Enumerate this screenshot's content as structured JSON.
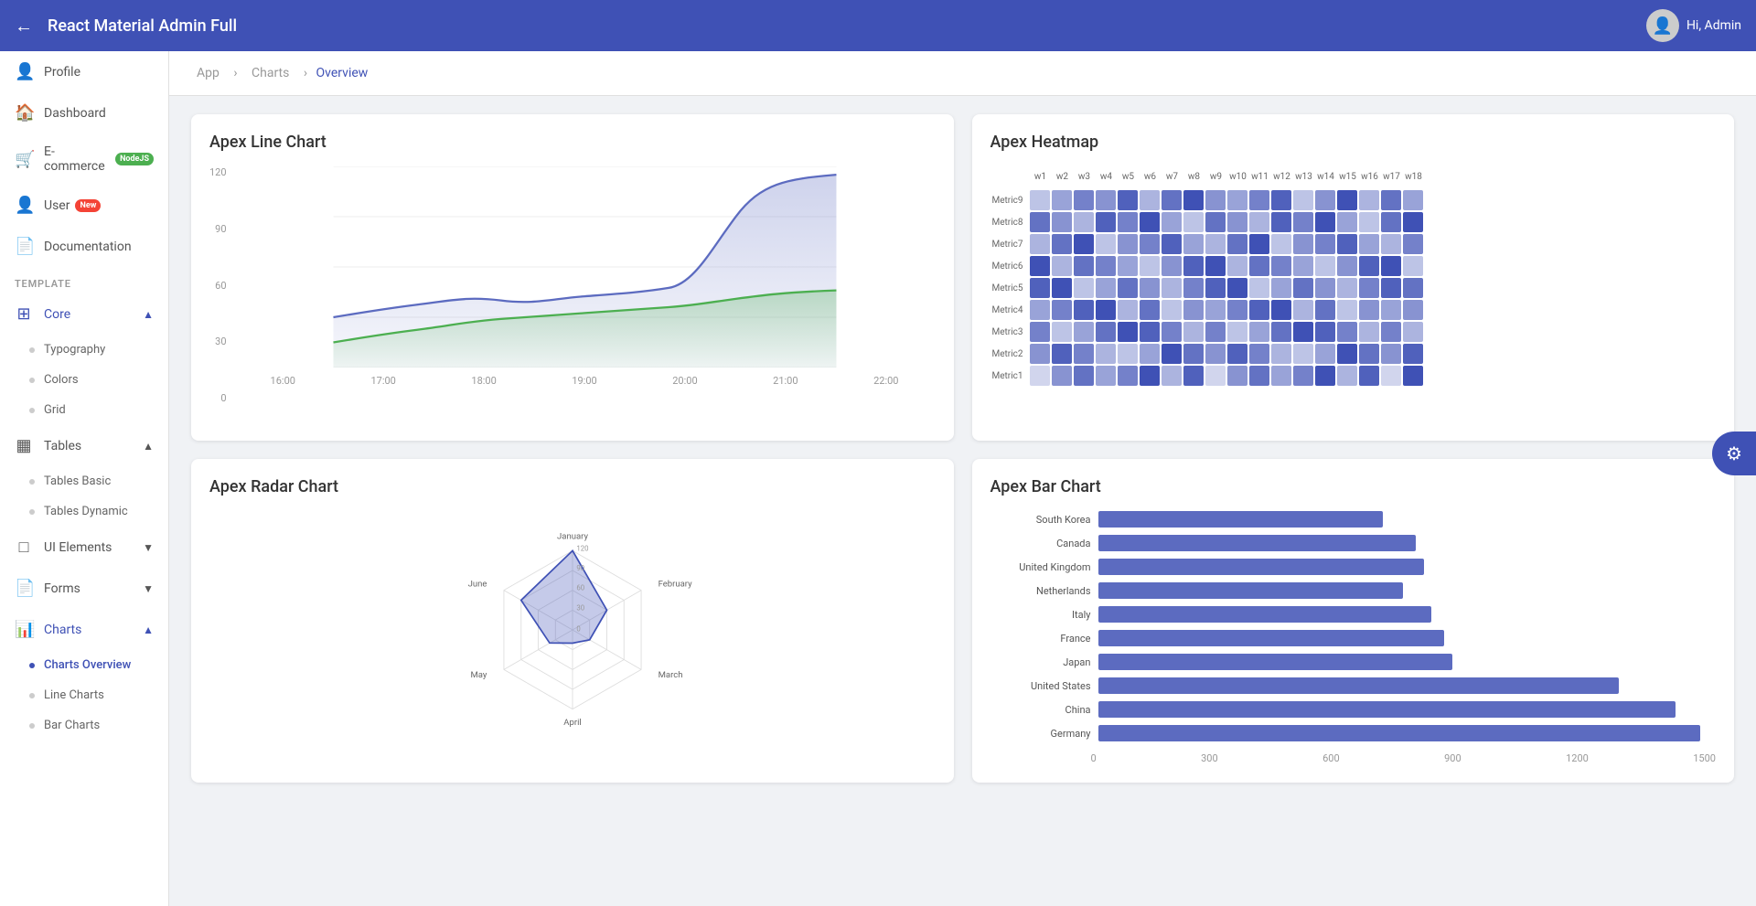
{
  "topbar": {
    "back_icon": "←",
    "title": "React Material Admin Full",
    "user_greeting": "Hi, Admin",
    "avatar_icon": "👤"
  },
  "sidebar": {
    "items": [
      {
        "id": "profile",
        "label": "Profile",
        "icon": "👤",
        "type": "item"
      },
      {
        "id": "dashboard",
        "label": "Dashboard",
        "icon": "🏠",
        "type": "item"
      },
      {
        "id": "ecommerce",
        "label": "E-commerce",
        "icon": "🛒",
        "type": "item",
        "badge": "NodeJS"
      },
      {
        "id": "user",
        "label": "User",
        "icon": "👤",
        "type": "item",
        "badge": "New"
      },
      {
        "id": "documentation",
        "label": "Documentation",
        "icon": "📄",
        "type": "item"
      }
    ],
    "template_label": "TEMPLATE",
    "template_groups": [
      {
        "id": "core",
        "label": "Core",
        "icon": "⊞",
        "expanded": true,
        "sub_items": [
          {
            "id": "typography",
            "label": "Typography"
          },
          {
            "id": "colors",
            "label": "Colors"
          },
          {
            "id": "grid",
            "label": "Grid"
          }
        ]
      },
      {
        "id": "tables",
        "label": "Tables",
        "icon": "▦",
        "expanded": true,
        "sub_items": [
          {
            "id": "tables-basic",
            "label": "Tables Basic"
          },
          {
            "id": "tables-dynamic",
            "label": "Tables Dynamic"
          }
        ]
      },
      {
        "id": "ui-elements",
        "label": "UI Elements",
        "icon": "□",
        "expanded": false,
        "sub_items": []
      },
      {
        "id": "forms",
        "label": "Forms",
        "icon": "📄",
        "expanded": false,
        "sub_items": []
      },
      {
        "id": "charts",
        "label": "Charts",
        "icon": "📊",
        "expanded": true,
        "sub_items": [
          {
            "id": "charts-overview",
            "label": "Charts Overview",
            "active": true
          },
          {
            "id": "line-charts",
            "label": "Line Charts"
          },
          {
            "id": "bar-charts",
            "label": "Bar Charts"
          }
        ]
      }
    ]
  },
  "breadcrumb": {
    "app": "App",
    "charts": "Charts",
    "overview": "Overview",
    "sep": ">"
  },
  "settings_fab": "⚙",
  "line_chart": {
    "title": "Apex Line Chart",
    "y_labels": [
      "120",
      "90",
      "60",
      "30",
      "0"
    ],
    "x_labels": [
      "16:00",
      "17:00",
      "18:00",
      "19:00",
      "20:00",
      "21:00",
      "22:00"
    ]
  },
  "heatmap": {
    "title": "Apex Heatmap",
    "row_labels": [
      "Metric9",
      "Metric8",
      "Metric7",
      "Metric6",
      "Metric5",
      "Metric4",
      "Metric3",
      "Metric2",
      "Metric1"
    ],
    "col_labels": [
      "w1",
      "w2",
      "w3",
      "w4",
      "w5",
      "w6",
      "w7",
      "w8",
      "w9",
      "w10",
      "w11",
      "w12",
      "w13",
      "w14",
      "w15",
      "w16",
      "w17",
      "w18"
    ],
    "data": [
      [
        2,
        4,
        6,
        5,
        8,
        3,
        7,
        9,
        5,
        4,
        6,
        8,
        2,
        5,
        9,
        3,
        7,
        4
      ],
      [
        7,
        5,
        3,
        8,
        6,
        9,
        4,
        2,
        7,
        5,
        3,
        8,
        6,
        9,
        4,
        2,
        7,
        9
      ],
      [
        3,
        7,
        9,
        2,
        5,
        6,
        8,
        4,
        3,
        7,
        9,
        2,
        5,
        6,
        8,
        4,
        3,
        6
      ],
      [
        9,
        3,
        7,
        6,
        4,
        2,
        5,
        8,
        9,
        3,
        7,
        6,
        4,
        2,
        5,
        8,
        9,
        2
      ],
      [
        8,
        9,
        2,
        4,
        7,
        5,
        3,
        6,
        8,
        9,
        2,
        4,
        7,
        5,
        3,
        6,
        8,
        7
      ],
      [
        4,
        6,
        8,
        9,
        3,
        7,
        2,
        5,
        4,
        6,
        8,
        9,
        3,
        7,
        2,
        5,
        4,
        5
      ],
      [
        6,
        2,
        4,
        7,
        9,
        8,
        6,
        3,
        6,
        2,
        4,
        7,
        9,
        8,
        6,
        3,
        6,
        3
      ],
      [
        5,
        8,
        6,
        3,
        2,
        4,
        9,
        7,
        5,
        8,
        6,
        3,
        2,
        4,
        9,
        7,
        5,
        8
      ],
      [
        1,
        5,
        7,
        4,
        6,
        9,
        3,
        8,
        1,
        5,
        7,
        4,
        6,
        9,
        3,
        8,
        1,
        9
      ]
    ]
  },
  "radar_chart": {
    "title": "Apex Radar Chart",
    "labels": [
      "January",
      "February",
      "March",
      "April",
      "May",
      "June"
    ],
    "values": [
      120,
      60,
      30,
      20,
      40,
      90
    ]
  },
  "bar_chart": {
    "title": "Apex Bar Chart",
    "max": 1500,
    "x_labels": [
      "0",
      "300",
      "600",
      "900",
      "1200",
      "1500"
    ],
    "items": [
      {
        "label": "South Korea",
        "value": 700
      },
      {
        "label": "Canada",
        "value": 780
      },
      {
        "label": "United Kingdom",
        "value": 800
      },
      {
        "label": "Netherlands",
        "value": 750
      },
      {
        "label": "Italy",
        "value": 820
      },
      {
        "label": "France",
        "value": 850
      },
      {
        "label": "Japan",
        "value": 870
      },
      {
        "label": "United States",
        "value": 1280
      },
      {
        "label": "China",
        "value": 1420
      },
      {
        "label": "Germany",
        "value": 1480
      }
    ]
  }
}
